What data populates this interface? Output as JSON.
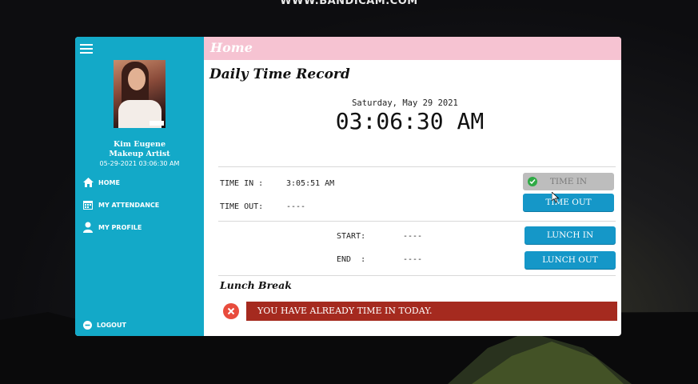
{
  "watermark": "WWW.BANDICAM.COM",
  "header": {
    "title": "Home"
  },
  "user": {
    "name": "Kim Eugene",
    "role": "Makeup Artist",
    "datetime": "05-29-2021 03:06:30 AM"
  },
  "sidebar": {
    "items": [
      {
        "label": "HOME",
        "icon": "home-icon"
      },
      {
        "label": "MY ATTENDANCE",
        "icon": "calendar-icon"
      },
      {
        "label": "MY PROFILE",
        "icon": "user-icon"
      }
    ],
    "logout_label": "LOGOUT"
  },
  "main": {
    "title": "Daily Time Record",
    "date": "Saturday, May 29 2021",
    "clock": "03:06:30 AM",
    "time_in_label": "TIME IN :",
    "time_in_value": "3:05:51 AM",
    "time_out_label": "TIME OUT:",
    "time_out_value": "----",
    "buttons": {
      "time_in": "TIME IN",
      "time_out": "TIME OUT",
      "lunch_in": "LUNCH IN",
      "lunch_out": "LUNCH OUT"
    },
    "lunch": {
      "label": "Lunch Break",
      "start_label": "START:",
      "start_value": "----",
      "end_label": "END  :",
      "end_value": "----"
    },
    "alert": "YOU HAVE ALREADY TIME IN TODAY."
  },
  "colors": {
    "sidebar": "#13a9c8",
    "header": "#f6c3d2",
    "button": "#1597c8",
    "alert": "#a52a1f",
    "alert_icon": "#e84c3d"
  }
}
